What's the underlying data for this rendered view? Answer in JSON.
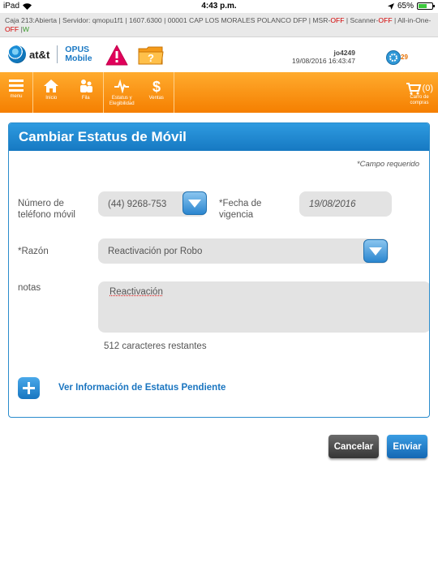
{
  "statusbar": {
    "device": "iPad",
    "time": "4:43 p.m.",
    "battery": "65%",
    "battery_level": 0.65
  },
  "infostrip": {
    "caja": "Caja 213:Abierta",
    "servidor": "Servidor: qmopu1f1",
    "version": "1607.6300",
    "store": "00001 CAP LOS MORALES POLANCO DFP",
    "msr_label": "MSR-",
    "msr_value": "OFF",
    "scanner_label": "Scanner-",
    "scanner_value": "OFF",
    "allinone_label": "All-in-One-",
    "allinone_value": "OFF",
    "w": "W",
    "sep": "|"
  },
  "header": {
    "brand": "at&t",
    "product_line1": "OPUS",
    "product_line2": "Mobile",
    "username": "jo4249",
    "datetime": "19/08/2016 16:43:47",
    "notification_count": "29"
  },
  "nav": {
    "items": [
      {
        "label": "menu"
      },
      {
        "label": "Inicio"
      },
      {
        "label": "Fila"
      },
      {
        "label": "Estatus y\nElegibilidad"
      },
      {
        "label": "Ventas"
      }
    ],
    "cart_count": "(0)",
    "cart_label": "Carro de compras"
  },
  "form": {
    "title": "Cambiar Estatus de Móvil",
    "required_note": "*Campo requerido",
    "phone_label": "Número de teléfono móvil",
    "phone_value": "(44) 9268-753",
    "date_label": "*Fecha de vigencia",
    "date_value": "19/08/2016",
    "reason_label": "*Razón",
    "reason_value": "Reactivación por Robo",
    "notes_label": "notas",
    "notes_value": "Reactivación",
    "chars_left": "512 caracteres restantes",
    "pending_link": "Ver Información de Estatus Pendiente"
  },
  "actions": {
    "cancel": "Cancelar",
    "send": "Enviar"
  }
}
